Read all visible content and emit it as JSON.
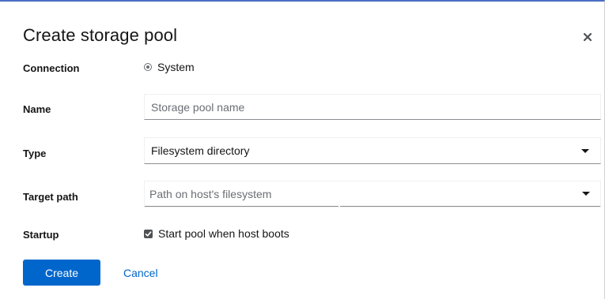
{
  "dialog": {
    "title": "Create storage pool",
    "close_icon": "close-icon"
  },
  "form": {
    "connection": {
      "label": "Connection",
      "option_label": "System",
      "selected": true
    },
    "name": {
      "label": "Name",
      "value": "",
      "placeholder": "Storage pool name"
    },
    "type": {
      "label": "Type",
      "selected_value": "Filesystem directory"
    },
    "target_path": {
      "label": "Target path",
      "value": "",
      "placeholder": "Path on host's filesystem"
    },
    "startup": {
      "label": "Startup",
      "checkbox_label": "Start pool when host boots",
      "checked": true
    }
  },
  "footer": {
    "create_label": "Create",
    "cancel_label": "Cancel"
  },
  "colors": {
    "primary": "#0066cc",
    "text": "#151515",
    "placeholder": "#6a6e73",
    "top_accent": "#4a6fc4"
  }
}
